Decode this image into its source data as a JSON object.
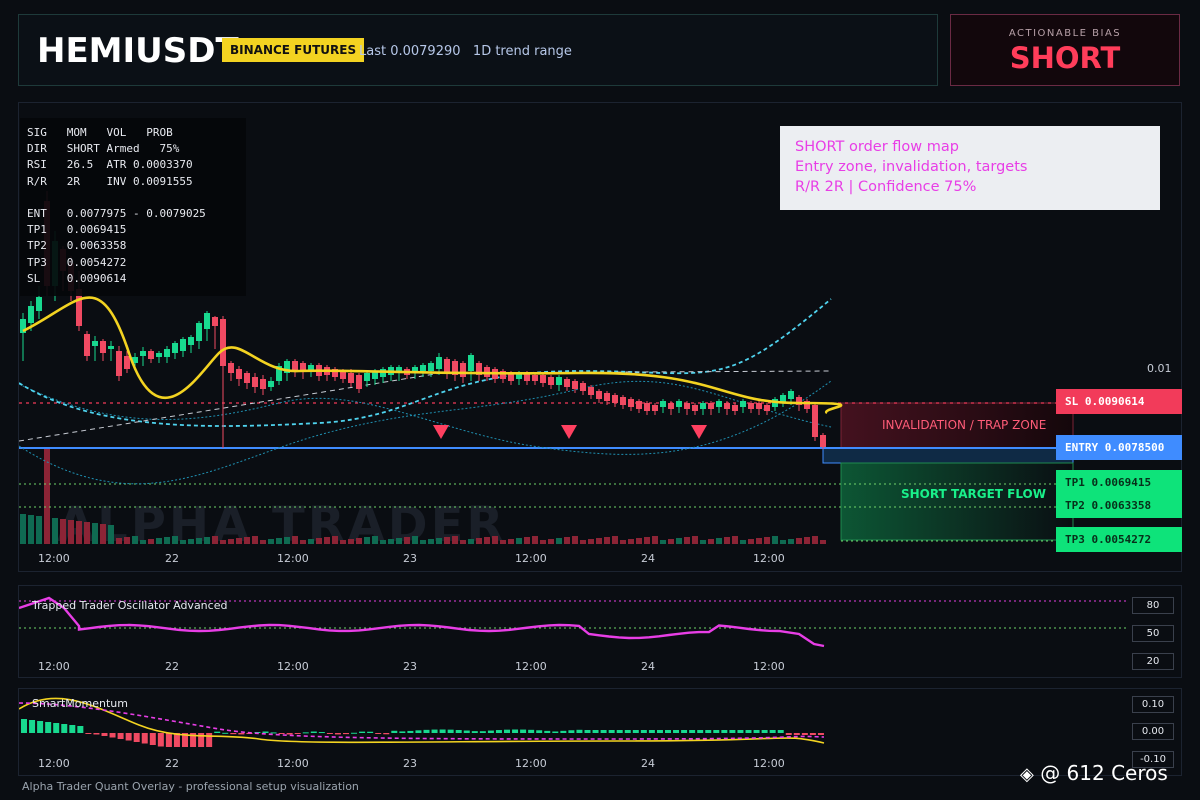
{
  "header": {
    "symbol": "HEMIUSDT",
    "exchange": "BINANCE FUTURES",
    "last": "Last 0.0079290",
    "trend": "1D trend range"
  },
  "bias": {
    "title": "ACTIONABLE BIAS",
    "value": "SHORT"
  },
  "info_box": {
    "lines": [
      "SIG   MOM   VOL   PROB",
      "DIR   SHORT Armed   75%",
      "RSI   26.5  ATR 0.0003370",
      "R/R   2R    INV 0.0091555",
      "",
      "ENT   0.0077975 - 0.0079025",
      "TP1   0.0069415",
      "TP2   0.0063358",
      "TP3   0.0054272",
      "SL    0.0090614"
    ]
  },
  "note": {
    "line1": "SHORT order flow map",
    "line2": "Entry zone, invalidation, targets",
    "line3": "R/R 2R | Confidence 75%"
  },
  "levels": {
    "sl": "SL 0.0090614",
    "entry": "ENTRY 0.0078500",
    "tp1": "TP1 0.0069415",
    "tp2": "TP2 0.0063358",
    "tp3": "TP3 0.0054272"
  },
  "zones": {
    "invalidation": "INVALIDATION / TRAP ZONE",
    "target": "SHORT TARGET FLOW"
  },
  "price_axis": {
    "label": "0.01"
  },
  "x_axis": [
    "12:00",
    "22",
    "12:00",
    "23",
    "12:00",
    "24",
    "12:00"
  ],
  "watermark_text": "ALPHA TRADER",
  "oscillator": {
    "title": "Trapped Trader Oscillator Advanced",
    "scale": [
      "80",
      "50",
      "20"
    ]
  },
  "momentum": {
    "title": "SmartMomentum",
    "scale": [
      "0.10",
      "0.00",
      "-0.10"
    ]
  },
  "footer": "Alpha Trader Quant Overlay - professional setup visualization",
  "credit": "@ 612 Ceros",
  "colors": {
    "bull": "#18d98f",
    "bear": "#f04a62",
    "sl": "#f23b5a",
    "entry": "#3f8cff",
    "tp": "#0ee37a",
    "ema": "#f3d321",
    "osc": "#e83ee6"
  }
}
